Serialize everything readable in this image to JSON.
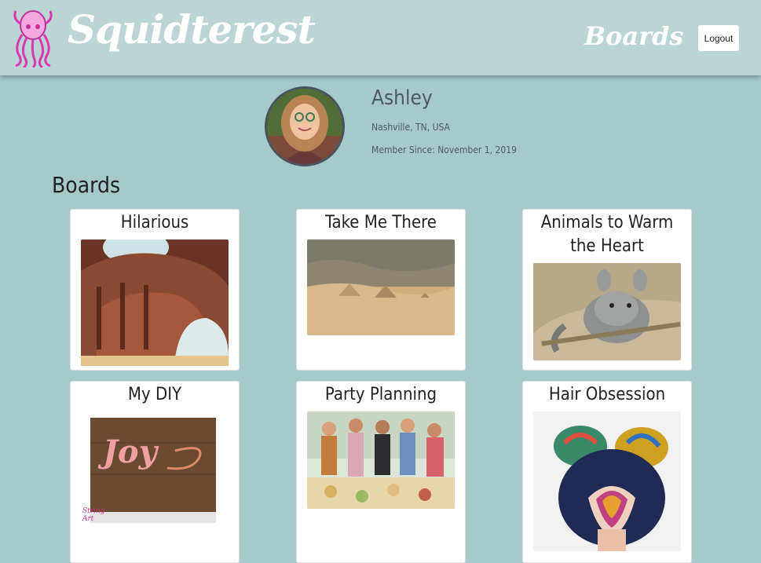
{
  "header": {
    "brand": "Squidterest",
    "nav_boards": "Boards",
    "logout": "Logout"
  },
  "profile": {
    "name": "Ashley",
    "location": "Nashville, TN, USA",
    "member_since": "Member Since: November 1, 2019"
  },
  "boards_heading": "Boards",
  "boards": [
    {
      "title": "Hilarious"
    },
    {
      "title": "Take Me There"
    },
    {
      "title": "Animals to Warm the Heart"
    },
    {
      "title": "My DIY"
    },
    {
      "title": "Party Planning"
    },
    {
      "title": "Hair Obsession"
    }
  ],
  "diy_image": {
    "word": "Joy",
    "badge": "String Art"
  },
  "colors": {
    "page_bg": "#a6cac9",
    "navbar_bg": "#bad5d4",
    "logo_pink": "#e040b8"
  }
}
